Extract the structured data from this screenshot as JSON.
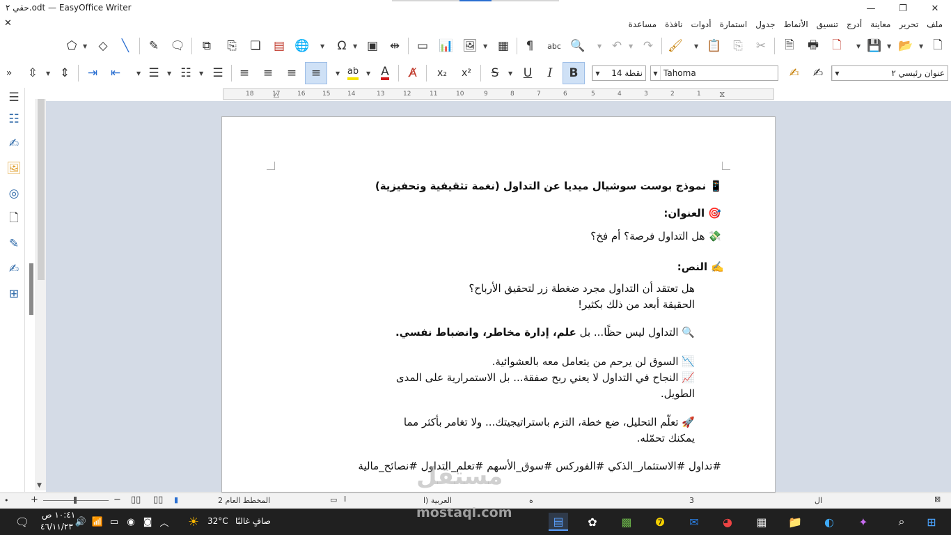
{
  "window": {
    "title": "حقي ٢.odt — EasyOffice Writer",
    "minimize": "—",
    "restore": "❐",
    "close": "✕",
    "doc_close": "✕"
  },
  "menu": [
    "ملف",
    "تحرير",
    "معاينة",
    "أدرج",
    "تنسيق",
    "الأنماط",
    "جدول",
    "استمارة",
    "أدوات",
    "نافذة",
    "مساعدة"
  ],
  "toolbar": {
    "paragraph_style": "عنوان رئيسي ٢",
    "font_name": "Tahoma",
    "font_size": "نقطة 14",
    "bold": "B",
    "italic": "I",
    "underline": "U",
    "strikethrough": "S",
    "superscript": "x²",
    "subscript": "x₂",
    "pilcrow": "¶",
    "spellcheck": "abc",
    "overflow": "»"
  },
  "ruler": [
    "18",
    "17",
    "16",
    "15",
    "14",
    "13",
    "12",
    "11",
    "10",
    "9",
    "8",
    "7",
    "6",
    "5",
    "4",
    "3",
    "2",
    "1"
  ],
  "document": {
    "title": "📱 نموذج بوست سوشيال ميديا عن التداول (نغمة تثقيفية وتحفيزية)",
    "heading_label": "🎯 العنوان:",
    "heading_text": "💸 هل التداول فرصة؟ أم فخ؟",
    "body_label": "✍️ النص:",
    "line1": "هل تعتقد أن التداول مجرد ضغطة زر لتحقيق الأرباح؟",
    "line2": "الحقيقة أبعد من ذلك بكثير!",
    "line3_prefix": "🔍 التداول ليس حظًا... بل ",
    "line3_bold": "علم، إدارة مخاطر، وانضباط نفسي.",
    "line4": "📉 السوق لن يرحم من يتعامل معه بالعشوائية.",
    "line5": "📈 النجاح في التداول لا يعني ربح صفقة... بل الاستمرارية على المدى",
    "line6": "الطويل.",
    "line7": "🚀 تعلّم التحليل، ضع خطة، التزم باستراتيجيتك... ولا تغامر بأكثر مما",
    "line8": "يمكنك تحمّله.",
    "hashtags": "#تداول #الاستثمار_الذكي #الفوركس #سوق_الأسهم #تعلم_التداول #نصائح_مالية"
  },
  "status": {
    "page": "3",
    "words": "ال",
    "language": "العربية (ا",
    "page_style": "المخطط العام 2",
    "zoom_minus": "−",
    "zoom_plus": "+",
    "dot": "•",
    "view_marker": "ه"
  },
  "taskbar": {
    "time": "١٠:٤١ ص",
    "date": "٤٦/١١/٢٣",
    "temperature": "32°C",
    "weather": "صافٍ غالبًا"
  },
  "watermark": {
    "brand": "مستقل",
    "site": "mostaql.com"
  },
  "colors": {
    "highlight": "#f5e400",
    "font_color": "#d01c1c",
    "workspace": "#d4dbe6",
    "active_button": "#cfe1f6"
  }
}
